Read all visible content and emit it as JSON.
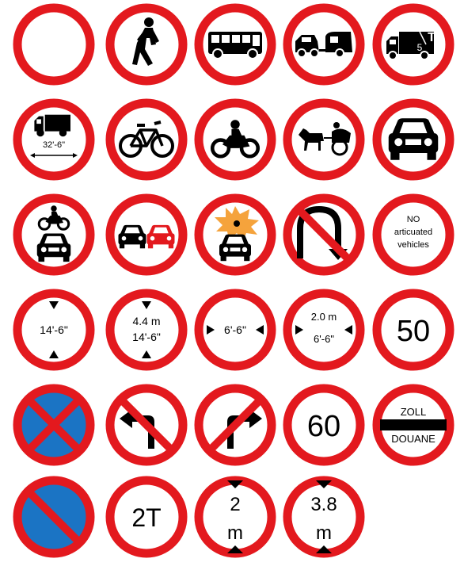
{
  "colors": {
    "red": "#e3191e",
    "black": "#000000",
    "white": "#ffffff",
    "blue": "#1b74c4",
    "orange": "#f5a33c"
  },
  "signs": [
    {
      "id": "plain",
      "icon": "empty-circle"
    },
    {
      "id": "pedestrians",
      "icon": "pedestrian-icon"
    },
    {
      "id": "buses",
      "icon": "bus-icon"
    },
    {
      "id": "towed-caravans",
      "icon": "car-caravan-icon"
    },
    {
      "id": "goods-vehicles-weight",
      "icon": "lorry-icon",
      "label": "5",
      "label2": "T"
    },
    {
      "id": "goods-vehicles-length",
      "icon": "lorry-length-icon",
      "label": "32'-6\""
    },
    {
      "id": "cycles",
      "icon": "bicycle-icon"
    },
    {
      "id": "motorcycles",
      "icon": "motorcycle-icon"
    },
    {
      "id": "horse-drawn",
      "icon": "horse-cart-icon"
    },
    {
      "id": "motor-vehicles",
      "icon": "car-front-icon"
    },
    {
      "id": "motor-vehicles-all",
      "icon": "motorcycle-car-icon"
    },
    {
      "id": "no-overtaking",
      "icon": "two-cars-icon"
    },
    {
      "id": "explosives",
      "icon": "explosion-car-icon"
    },
    {
      "id": "no-u-turn",
      "icon": "u-turn-icon"
    },
    {
      "id": "no-articulated",
      "icon": "text-sign",
      "lines": [
        "NO",
        "articuated",
        "vehicles"
      ]
    },
    {
      "id": "height-limit",
      "icon": "height-limit-icon",
      "label": "14'-6\""
    },
    {
      "id": "height-limit-dual",
      "icon": "height-limit-icon",
      "label": "4.4 m",
      "label2": "14'-6\""
    },
    {
      "id": "width-limit",
      "icon": "width-limit-icon",
      "label": "6'-6\""
    },
    {
      "id": "width-limit-dual",
      "icon": "width-limit-icon",
      "label": "2.0 m",
      "label2": "6'-6\""
    },
    {
      "id": "speed-50",
      "icon": "speed-limit-icon",
      "label": "50"
    },
    {
      "id": "clearway",
      "icon": "no-stopping-icon"
    },
    {
      "id": "no-left-turn",
      "icon": "no-left-turn-icon"
    },
    {
      "id": "no-right-turn",
      "icon": "no-right-turn-icon"
    },
    {
      "id": "speed-60",
      "icon": "speed-limit-icon",
      "label": "60"
    },
    {
      "id": "customs",
      "icon": "customs-icon",
      "label": "ZOLL",
      "label2": "DOUANE"
    },
    {
      "id": "no-waiting",
      "icon": "no-waiting-icon"
    },
    {
      "id": "weight-2t",
      "icon": "weight-limit-icon",
      "label": "2T"
    },
    {
      "id": "height-2m",
      "icon": "height-metric-icon",
      "label": "2",
      "label2": "m"
    },
    {
      "id": "height-3-8m",
      "icon": "height-metric-icon",
      "label": "3.8",
      "label2": "m"
    }
  ]
}
